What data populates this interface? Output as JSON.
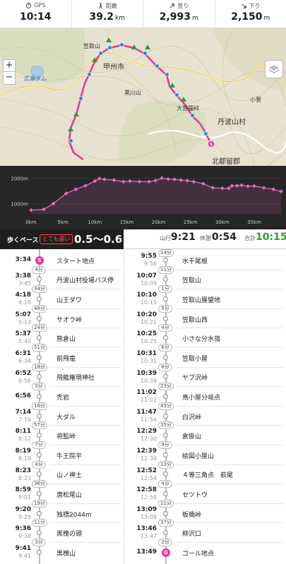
{
  "stats": [
    {
      "label": "GPS",
      "value": "10:14",
      "unit": "",
      "icon": "stopwatch-icon"
    },
    {
      "label": "距離",
      "value": "39.2",
      "unit": "km",
      "icon": "hiker-icon"
    },
    {
      "label": "登り",
      "value": "2,993",
      "unit": "m",
      "icon": "arrow-up-right-icon"
    },
    {
      "label": "下り",
      "value": "2,150",
      "unit": "m",
      "icon": "arrow-down-right-icon"
    }
  ],
  "map": {
    "zoom_in": "+",
    "zoom_out": "−",
    "labels": [
      {
        "text": "甲州市",
        "kind": "big"
      },
      {
        "text": "丹波山村",
        "kind": "big"
      },
      {
        "text": "北都留郡",
        "kind": "big"
      },
      {
        "text": "広瀬ダム",
        "kind": "water"
      },
      {
        "text": "大菩薩峠",
        "kind": "normal"
      },
      {
        "text": "笠取山",
        "kind": "normal"
      },
      {
        "text": "黒川山",
        "kind": "normal"
      },
      {
        "text": "小菅",
        "kind": "normal"
      }
    ],
    "colors": {
      "route": "#e23c95",
      "checkpoint": "#1e88c8",
      "summit": "#2e9b48"
    }
  },
  "chart_data": {
    "type": "area",
    "title": "",
    "xlabel": "",
    "ylabel": "",
    "x_ticks": [
      "0km",
      "5km",
      "10km",
      "15km",
      "20km",
      "25km",
      "30km",
      "35km"
    ],
    "y_ticks": [
      "1000m",
      "2000m"
    ],
    "xlim": [
      0,
      39.2
    ],
    "ylim": [
      600,
      2200
    ],
    "x": [
      0,
      2,
      3.5,
      5.5,
      7,
      8.5,
      10,
      10.7,
      11.5,
      13,
      14.5,
      15.5,
      17,
      18.5,
      19.5,
      20.5,
      21.5,
      22.5,
      23.5,
      24.5,
      25.5,
      27,
      28.5,
      30,
      31,
      31.5,
      32.3,
      33,
      34,
      35,
      36.5,
      38,
      39.2
    ],
    "y": [
      750,
      780,
      1000,
      1400,
      1560,
      1700,
      1880,
      1980,
      1950,
      1920,
      1860,
      1880,
      1860,
      1860,
      1900,
      2000,
      1960,
      1950,
      1920,
      1900,
      1860,
      1780,
      1620,
      1600,
      1600,
      1700,
      1700,
      1720,
      1680,
      1690,
      1620,
      1560,
      1480
    ],
    "color": "#e56bbd"
  },
  "pace": {
    "label": "歩くペース",
    "badge": "とても遅い",
    "range": "0.5～0.6"
  },
  "time_summary": [
    {
      "label": "山行",
      "value": "9:21"
    },
    {
      "label": "休憩",
      "value": "0:54"
    },
    {
      "label": "合計",
      "value": "10:15"
    }
  ],
  "left_column": {
    "waypoints": [
      {
        "arr": "3:34",
        "dep": "",
        "name": "スタート地点",
        "marker": "S",
        "kind": "start"
      },
      {
        "arr": "3:38",
        "dep": "3:45",
        "name": "丹波山村役場バス停",
        "marker": "",
        "kind": "normal"
      },
      {
        "arr": "4:18",
        "dep": "4:19",
        "name": "山王ダワ",
        "marker": "",
        "kind": "normal"
      },
      {
        "arr": "5:07",
        "dep": "5:13",
        "name": "サオラ峠",
        "marker": "",
        "kind": "normal"
      },
      {
        "arr": "5:37",
        "dep": "5:40",
        "name": "熊倉山",
        "marker": "",
        "kind": "normal"
      },
      {
        "arr": "6:31",
        "dep": "6:34",
        "name": "前飛竜",
        "marker": "",
        "kind": "normal"
      },
      {
        "arr": "6:52",
        "dep": "6:56",
        "name": "飛龍権現神社",
        "marker": "",
        "kind": "normal"
      },
      {
        "arr": "6:56",
        "dep": "",
        "name": "禿岩",
        "marker": "",
        "kind": "normal"
      },
      {
        "arr": "7:14",
        "dep": "7:16",
        "name": "大ダル",
        "marker": "",
        "kind": "normal"
      },
      {
        "arr": "8:11",
        "dep": "8:12",
        "name": "将監峠",
        "marker": "",
        "kind": "normal"
      },
      {
        "arr": "8:19",
        "dep": "8:19",
        "name": "牛王院平",
        "marker": "",
        "kind": "normal"
      },
      {
        "arr": "8:23",
        "dep": "8:23",
        "name": "山ノ神土",
        "marker": "",
        "kind": "normal"
      },
      {
        "arr": "8:59",
        "dep": "9:01",
        "name": "唐松尾山",
        "marker": "",
        "kind": "normal"
      },
      {
        "arr": "9:20",
        "dep": "9:25",
        "name": "独標2044m",
        "marker": "",
        "kind": "normal"
      },
      {
        "arr": "9:36",
        "dep": "9:38",
        "name": "黒槐の頭",
        "marker": "",
        "kind": "normal"
      },
      {
        "arr": "9:41",
        "dep": "9:41",
        "name": "黒槐山",
        "marker": "",
        "kind": "normal"
      }
    ],
    "durations": [
      "4分",
      "34分",
      "48分",
      "24分",
      "51分",
      "18分",
      "0分",
      "18分",
      "57分",
      "7分",
      "4分",
      "36分",
      "19分",
      "11分",
      "3分"
    ]
  },
  "right_column": {
    "waypoints": [
      {
        "arr": "9:55",
        "dep": "9:56",
        "name": "水干尾根",
        "marker": "",
        "kind": "normal"
      },
      {
        "arr": "10:07",
        "dep": "10:09",
        "name": "笠取山",
        "marker": "",
        "kind": "normal"
      },
      {
        "arr": "10:10",
        "dep": "10:15",
        "name": "笠取山展望地",
        "marker": "",
        "kind": "normal"
      },
      {
        "arr": "10:20",
        "dep": "10:21",
        "name": "笠取山西",
        "marker": "",
        "kind": "normal"
      },
      {
        "arr": "10:25",
        "dep": "10:25",
        "name": "小さな分水嶺",
        "marker": "",
        "kind": "normal"
      },
      {
        "arr": "10:31",
        "dep": "10:31",
        "name": "笠取小屋",
        "marker": "",
        "kind": "normal"
      },
      {
        "arr": "10:39",
        "dep": "10:39",
        "name": "ヤブ沢峠",
        "marker": "",
        "kind": "normal"
      },
      {
        "arr": "11:02",
        "dep": "11:02",
        "name": "鳥小屋分岐点",
        "marker": "",
        "kind": "normal"
      },
      {
        "arr": "11:47",
        "dep": "11:54",
        "name": "白沢峠",
        "marker": "",
        "kind": "normal"
      },
      {
        "arr": "12:29",
        "dep": "12:30",
        "name": "倉掛山",
        "marker": "",
        "kind": "normal"
      },
      {
        "arr": "12:39",
        "dep": "12:39",
        "name": "絵図小屋山",
        "marker": "",
        "kind": "normal"
      },
      {
        "arr": "12:52",
        "dep": "12:54",
        "name": "４等三角点　萩尾",
        "marker": "",
        "kind": "normal"
      },
      {
        "arr": "12:58",
        "dep": "12:58",
        "name": "セツトウ",
        "marker": "",
        "kind": "normal"
      },
      {
        "arr": "13:09",
        "dep": "13:09",
        "name": "板橋峠",
        "marker": "",
        "kind": "normal"
      },
      {
        "arr": "13:46",
        "dep": "13:47",
        "name": "柳沢口",
        "marker": "",
        "kind": "normal"
      },
      {
        "arr": "13:49",
        "dep": "",
        "name": "ゴール地点",
        "marker": "G",
        "kind": "goal"
      }
    ],
    "top_duration": "14分",
    "durations": [
      "11分",
      "1分",
      "5分",
      "4分",
      "6分",
      "8分",
      "23分",
      "45分",
      "35分",
      "9分",
      "13分",
      "4分",
      "11分",
      "37分",
      "2分"
    ]
  }
}
